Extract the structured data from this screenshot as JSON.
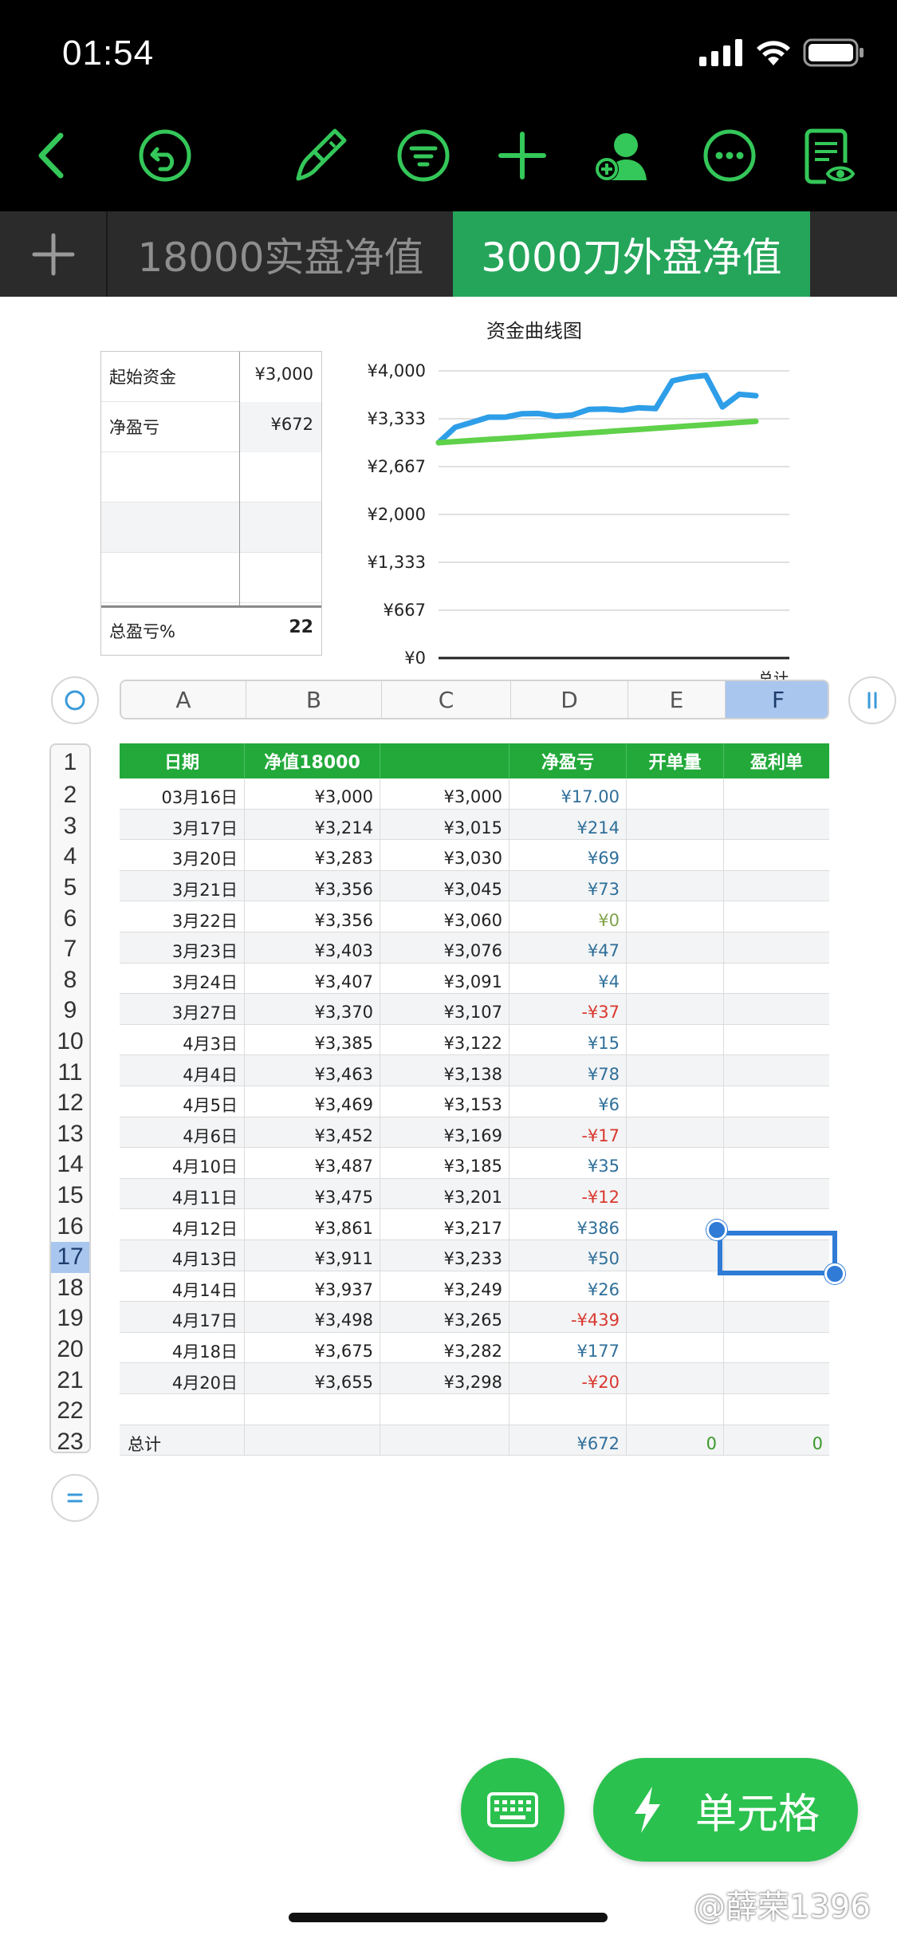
{
  "status_bar": {
    "time": "01:54"
  },
  "sheet_tabs": [
    {
      "label": "18000实盘净值",
      "active": false
    },
    {
      "label": "3000刀外盘净值",
      "active": true
    }
  ],
  "summary_table": {
    "rows": [
      {
        "label": "起始资金",
        "value": "¥3,000"
      },
      {
        "label": "净盈亏",
        "value": "¥672"
      },
      {
        "label": "",
        "value": ""
      },
      {
        "label": "",
        "value": ""
      },
      {
        "label": "",
        "value": ""
      }
    ],
    "footer": {
      "label": "总盈亏%",
      "value": "22"
    }
  },
  "chart_data": {
    "type": "line",
    "title": "资金曲线图",
    "y_ticks": [
      "¥4,000",
      "¥3,333",
      "¥2,667",
      "¥2,000",
      "¥1,333",
      "¥667",
      "¥0"
    ],
    "ylim": [
      0,
      4000
    ],
    "x_tick_partial": "总计",
    "series": [
      {
        "color": "#2e9ee8",
        "values": [
          3000,
          3214,
          3283,
          3356,
          3356,
          3403,
          3407,
          3370,
          3385,
          3463,
          3469,
          3452,
          3487,
          3475,
          3861,
          3911,
          3937,
          3498,
          3675,
          3655
        ]
      },
      {
        "color": "#5fd14a",
        "values": [
          3000,
          3015,
          3030,
          3045,
          3060,
          3076,
          3091,
          3107,
          3122,
          3138,
          3153,
          3169,
          3185,
          3201,
          3217,
          3233,
          3249,
          3265,
          3282,
          3298
        ]
      }
    ],
    "grid": true
  },
  "columns": [
    "A",
    "B",
    "C",
    "D",
    "E",
    "F"
  ],
  "selected_column": "F",
  "row_numbers": [
    "1",
    "2",
    "3",
    "4",
    "5",
    "6",
    "7",
    "8",
    "9",
    "10",
    "11",
    "12",
    "13",
    "14",
    "15",
    "16",
    "17",
    "18",
    "19",
    "20",
    "21",
    "22",
    "23"
  ],
  "selected_row": "17",
  "table": {
    "headers": [
      "日期",
      "净值18000",
      "",
      "净盈亏",
      "开单量",
      "盈利单"
    ],
    "rows": [
      [
        "03月16日",
        "¥3,000",
        "¥3,000",
        "¥17.00",
        "",
        ""
      ],
      [
        "3月17日",
        "¥3,214",
        "¥3,015",
        "¥214",
        "",
        ""
      ],
      [
        "3月20日",
        "¥3,283",
        "¥3,030",
        "¥69",
        "",
        ""
      ],
      [
        "3月21日",
        "¥3,356",
        "¥3,045",
        "¥73",
        "",
        ""
      ],
      [
        "3月22日",
        "¥3,356",
        "¥3,060",
        "¥0",
        "",
        ""
      ],
      [
        "3月23日",
        "¥3,403",
        "¥3,076",
        "¥47",
        "",
        ""
      ],
      [
        "3月24日",
        "¥3,407",
        "¥3,091",
        "¥4",
        "",
        ""
      ],
      [
        "3月27日",
        "¥3,370",
        "¥3,107",
        "-¥37",
        "",
        ""
      ],
      [
        "4月3日",
        "¥3,385",
        "¥3,122",
        "¥15",
        "",
        ""
      ],
      [
        "4月4日",
        "¥3,463",
        "¥3,138",
        "¥78",
        "",
        ""
      ],
      [
        "4月5日",
        "¥3,469",
        "¥3,153",
        "¥6",
        "",
        ""
      ],
      [
        "4月6日",
        "¥3,452",
        "¥3,169",
        "-¥17",
        "",
        ""
      ],
      [
        "4月10日",
        "¥3,487",
        "¥3,185",
        "¥35",
        "",
        ""
      ],
      [
        "4月11日",
        "¥3,475",
        "¥3,201",
        "-¥12",
        "",
        ""
      ],
      [
        "4月12日",
        "¥3,861",
        "¥3,217",
        "¥386",
        "",
        ""
      ],
      [
        "4月13日",
        "¥3,911",
        "¥3,233",
        "¥50",
        "",
        ""
      ],
      [
        "4月14日",
        "¥3,937",
        "¥3,249",
        "¥26",
        "",
        ""
      ],
      [
        "4月17日",
        "¥3,498",
        "¥3,265",
        "-¥439",
        "",
        ""
      ],
      [
        "4月18日",
        "¥3,675",
        "¥3,282",
        "¥177",
        "",
        ""
      ],
      [
        "4月20日",
        "¥3,655",
        "¥3,298",
        "-¥20",
        "",
        ""
      ],
      [
        "",
        "",
        "",
        "",
        "",
        ""
      ]
    ],
    "total_row": [
      "总计",
      "",
      "",
      "¥672",
      "0",
      "0"
    ]
  },
  "buttons": {
    "cell_label": "单元格"
  },
  "watermark": "@薛荣1396",
  "colors": {
    "accent": "#2bc14f",
    "header_green": "#22a93a",
    "selection": "#2f7bd6",
    "positive": "#2f6f9a",
    "negative": "#d9382f"
  },
  "icons": [
    "back-icon",
    "undo-icon",
    "paintbrush-icon",
    "filter-icon",
    "add-icon",
    "collaborate-icon",
    "more-icon",
    "view-document-icon",
    "keyboard-icon",
    "lightning-icon"
  ]
}
